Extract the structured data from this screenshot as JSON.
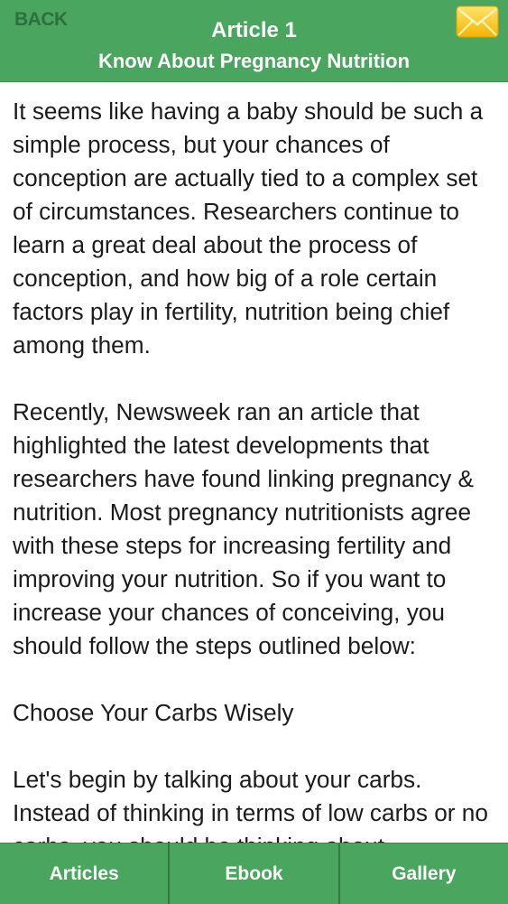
{
  "header": {
    "back_label": "BACK",
    "title": "Article 1",
    "subtitle": "Know About Pregnancy Nutrition",
    "mail_icon": "envelope-icon",
    "background_color": "#4aa55e"
  },
  "article": {
    "paragraphs": [
      "It seems like having a baby should be such a simple process, but your chances of conception are actually tied to a complex set of circumstances. Researchers continue to learn a great deal about the process of conception, and how big of a role certain factors play in fertility, nutrition being chief among them.",
      "Recently, Newsweek ran an article that highlighted the latest developments that researchers have found linking pregnancy & nutrition. Most pregnancy nutritionists agree with these steps for increasing fertility and improving your nutrition. So if you want to increase your chances of conceiving, you should follow the steps outlined below:",
      "Choose Your Carbs Wisely",
      "Let's begin by talking about your carbs. Instead of thinking in terms of low carbs or no carbs, you should be thinking about"
    ]
  },
  "tabbar": {
    "tabs": [
      {
        "label": "Articles"
      },
      {
        "label": "Ebook"
      },
      {
        "label": "Gallery"
      }
    ]
  }
}
